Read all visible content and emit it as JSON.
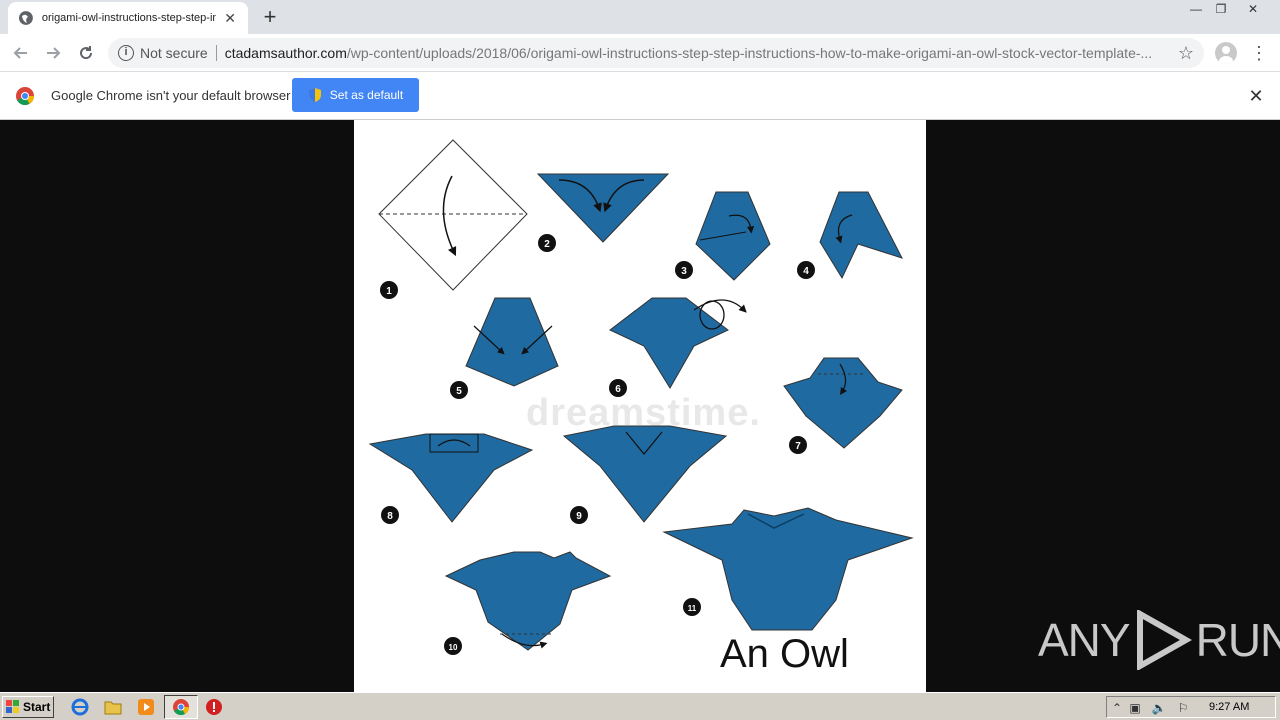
{
  "browser": {
    "tab_title": "origami-owl-instructions-step-step-in",
    "tab_close": "✕",
    "new_tab": "+",
    "omnibox": {
      "security_label": "Not secure",
      "url_host": "ctadamsauthor.com",
      "url_path": "/wp-content/uploads/2018/06/origami-owl-instructions-step-step-instructions-how-to-make-origami-an-owl-stock-vector-template-..."
    },
    "window_controls": [
      "—",
      "❐",
      "✕"
    ]
  },
  "infobar": {
    "message": "Google Chrome isn't your default browser",
    "button_label": "Set as default",
    "close": "✕"
  },
  "image": {
    "caption": "An Owl",
    "watermark": "dreamstime.",
    "step_numbers": [
      "1",
      "2",
      "3",
      "4",
      "5",
      "6",
      "7",
      "8",
      "9",
      "10",
      "11"
    ],
    "paper_color": "#1f6aa0"
  },
  "overlay_brand": {
    "left": "ANY",
    "right": "RUN"
  },
  "taskbar": {
    "start_label": "Start",
    "clock": "9:27 AM"
  }
}
